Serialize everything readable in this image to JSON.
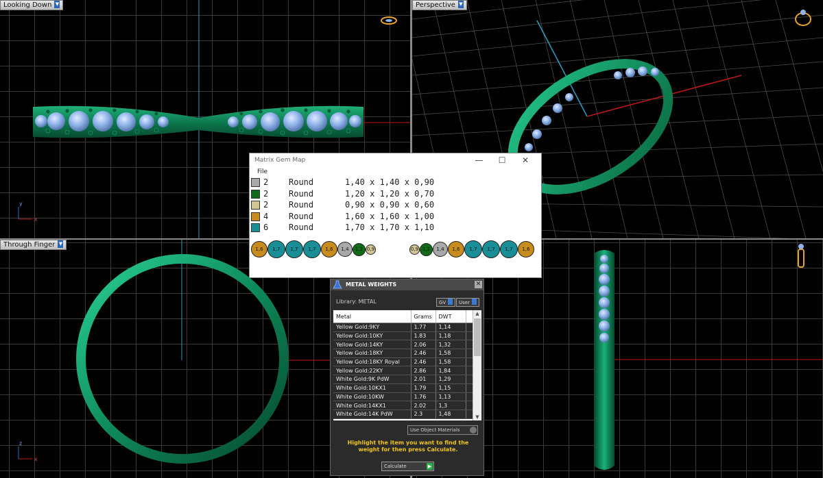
{
  "viewports": {
    "top_left": {
      "label": "Looking Down"
    },
    "top_right": {
      "label": "Perspective"
    },
    "bottom_left": {
      "label": "Through Finger"
    },
    "bottom_right": {
      "label": ""
    }
  },
  "axis_labels": {
    "top_left": {
      "vertical": "y",
      "horizontal": "x"
    },
    "bottom_left": {
      "vertical": "z",
      "horizontal": "x"
    }
  },
  "gem_map": {
    "title": "Matrix Gem Map",
    "menu_file": "File",
    "rows": [
      {
        "color": "#a9a9a9",
        "count": "2",
        "shape": "Round",
        "dims": "1,40 x 1,40 x 0,90"
      },
      {
        "color": "#0f6b18",
        "count": "2",
        "shape": "Round",
        "dims": "1,20 x 1,20 x 0,70"
      },
      {
        "color": "#cfc694",
        "count": "2",
        "shape": "Round",
        "dims": "0,90 x 0,90 x 0,60"
      },
      {
        "color": "#c88b1e",
        "count": "4",
        "shape": "Round",
        "dims": "1,60 x 1,60 x 1,00"
      },
      {
        "color": "#1a8e97",
        "count": "6",
        "shape": "Round",
        "dims": "1,70 x 1,70 x 1,10"
      }
    ],
    "strip_left": [
      {
        "label": "1,6",
        "color": "#c88b1e"
      },
      {
        "label": "1,7",
        "color": "#1a8e97"
      },
      {
        "label": "1,7",
        "color": "#1a8e97"
      },
      {
        "label": "1,7",
        "color": "#1a8e97"
      },
      {
        "label": "1,6",
        "color": "#c88b1e"
      },
      {
        "label": "1,4",
        "color": "#a9a9a9"
      },
      {
        "label": "1,2",
        "color": "#0f6b18"
      },
      {
        "label": "0,9",
        "color": "#cfc694"
      }
    ],
    "strip_right": [
      {
        "label": "0,9",
        "color": "#cfc694"
      },
      {
        "label": "1,2",
        "color": "#0f6b18"
      },
      {
        "label": "1,4",
        "color": "#a9a9a9"
      },
      {
        "label": "1,6",
        "color": "#c88b1e"
      },
      {
        "label": "1,7",
        "color": "#1a8e97"
      },
      {
        "label": "1,7",
        "color": "#1a8e97"
      },
      {
        "label": "1,7",
        "color": "#1a8e97"
      },
      {
        "label": "1,6",
        "color": "#c88b1e"
      }
    ]
  },
  "metal_weights": {
    "title": "METAL WEIGHTS",
    "library_label": "Library: METAL",
    "btn_gv": "GV",
    "btn_user": "User",
    "columns": [
      "Metal",
      "Grams",
      "DWT"
    ],
    "rows": [
      {
        "metal": "Yellow Gold:9KY",
        "grams": "1.77",
        "dwt": "1,14"
      },
      {
        "metal": "Yellow Gold:10KY",
        "grams": "1.83",
        "dwt": "1,18"
      },
      {
        "metal": "Yellow Gold:14KY",
        "grams": "2.06",
        "dwt": "1,32"
      },
      {
        "metal": "Yellow Gold:18KY",
        "grams": "2.46",
        "dwt": "1,58"
      },
      {
        "metal": "Yellow Gold:18KY Royal",
        "grams": "2.46",
        "dwt": "1,58"
      },
      {
        "metal": "Yellow Gold:22KY",
        "grams": "2.86",
        "dwt": "1,84"
      },
      {
        "metal": "White Gold:9K PdW",
        "grams": "2.01",
        "dwt": "1,29"
      },
      {
        "metal": "White Gold:10KX1",
        "grams": "1.79",
        "dwt": "1,15"
      },
      {
        "metal": "White Gold:10KW",
        "grams": "1.76",
        "dwt": "1,13"
      },
      {
        "metal": "White Gold:14KX1",
        "grams": "2.02",
        "dwt": "1,3"
      },
      {
        "metal": "White Gold:14K PdW",
        "grams": "2.3",
        "dwt": "1,48"
      }
    ],
    "materials_select": "Use Object Materials",
    "hint": "Highlight the item you want to find the weight for then press Calculate.",
    "calculate_label": "Calculate"
  },
  "colors": {
    "ring_metal": "#0f8a5c",
    "gem_blue": "#8fb3e8",
    "axis_red": "#c01818",
    "axis_cyan": "#2a9fc4",
    "hint_yellow": "#f0c419"
  }
}
